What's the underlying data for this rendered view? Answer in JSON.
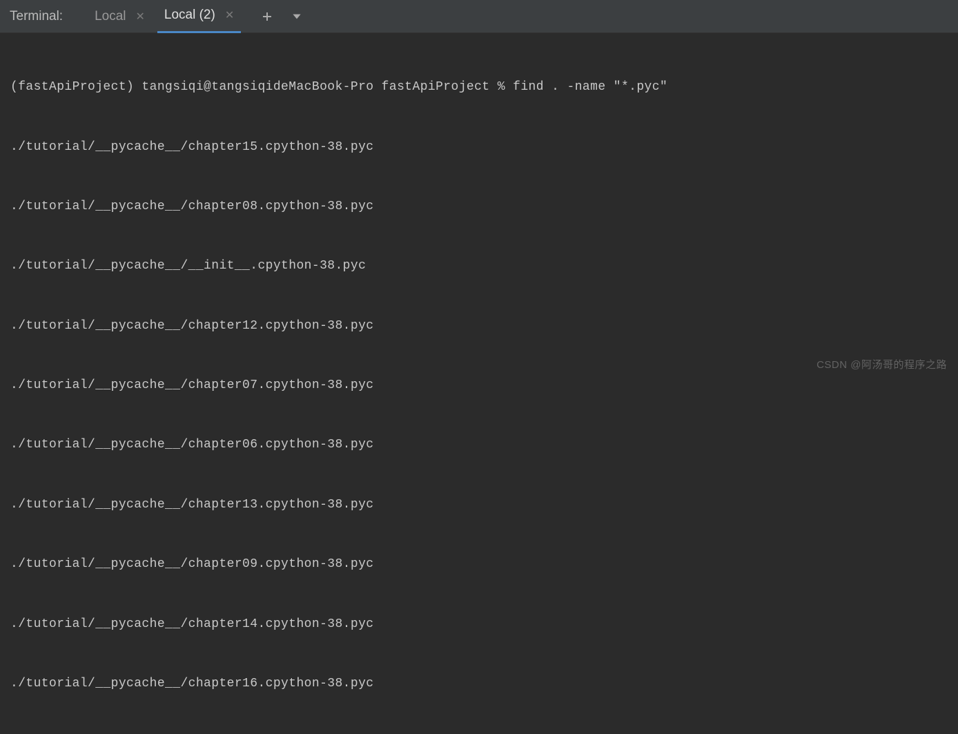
{
  "toolbar": {
    "label": "Terminal:",
    "tabs": [
      {
        "label": "Local",
        "active": false
      },
      {
        "label": "Local (2)",
        "active": true
      }
    ]
  },
  "terminal": {
    "prompt": "(fastApiProject) tangsiqi@tangsiqideMacBook-Pro fastApiProject % find . -name \"*.pyc\"",
    "output": [
      "./tutorial/__pycache__/chapter15.cpython-38.pyc",
      "./tutorial/__pycache__/chapter08.cpython-38.pyc",
      "./tutorial/__pycache__/__init__.cpython-38.pyc",
      "./tutorial/__pycache__/chapter12.cpython-38.pyc",
      "./tutorial/__pycache__/chapter07.cpython-38.pyc",
      "./tutorial/__pycache__/chapter06.cpython-38.pyc",
      "./tutorial/__pycache__/chapter13.cpython-38.pyc",
      "./tutorial/__pycache__/chapter09.cpython-38.pyc",
      "./tutorial/__pycache__/chapter14.cpython-38.pyc",
      "./tutorial/__pycache__/chapter16.cpython-38.pyc"
    ]
  },
  "watermark": "CSDN @阿汤哥的程序之路"
}
